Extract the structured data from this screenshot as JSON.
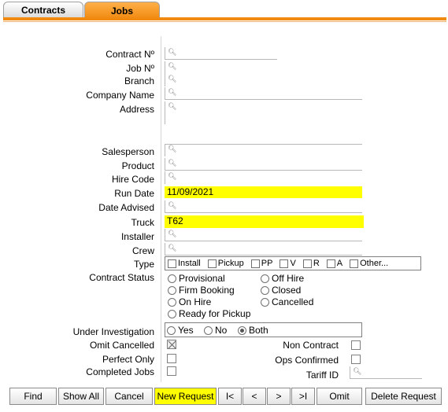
{
  "tabs": [
    {
      "label": "Contracts"
    },
    {
      "label": "Jobs"
    }
  ],
  "labels": {
    "contract_no": "Contract Nº",
    "job_no": "Job Nº",
    "branch": "Branch",
    "company_name": "Company Name",
    "address": "Address",
    "salesperson": "Salesperson",
    "product": "Product",
    "hire_code": "Hire Code",
    "run_date": "Run Date",
    "date_advised": "Date Advised",
    "truck": "Truck",
    "installer": "Installer",
    "crew": "Crew",
    "type": "Type",
    "contract_status": "Contract Status",
    "under_investigation": "Under Investigation",
    "omit_cancelled": "Omit Cancelled",
    "perfect_only": "Perfect Only",
    "completed_jobs": "Completed Jobs",
    "non_contract": "Non Contract",
    "ops_confirmed": "Ops Confirmed",
    "tariff_id": "Tariff ID"
  },
  "values": {
    "run_date": "11/09/2021",
    "truck": "T62"
  },
  "type_options": [
    "Install",
    "Pickup",
    "PP",
    "V",
    "R",
    "A",
    "Other..."
  ],
  "status_options": [
    "Provisional",
    "Off Hire",
    "Firm Booking",
    "Closed",
    "On Hire",
    "Cancelled",
    "Ready for Pickup"
  ],
  "investigation_options": [
    "Yes",
    "No",
    "Both"
  ],
  "investigation_selected": "Both",
  "omit_cancelled_checked": true,
  "buttons": {
    "find": "Find",
    "show_all": "Show All",
    "cancel": "Cancel",
    "new_request": "New Request",
    "first": "I<",
    "prev": "<",
    "next": ">",
    "last": ">I",
    "omit": "Omit",
    "delete_request": "Delete Request"
  },
  "colors": {
    "accent": "#f08a10",
    "highlight": "#ffff00"
  }
}
